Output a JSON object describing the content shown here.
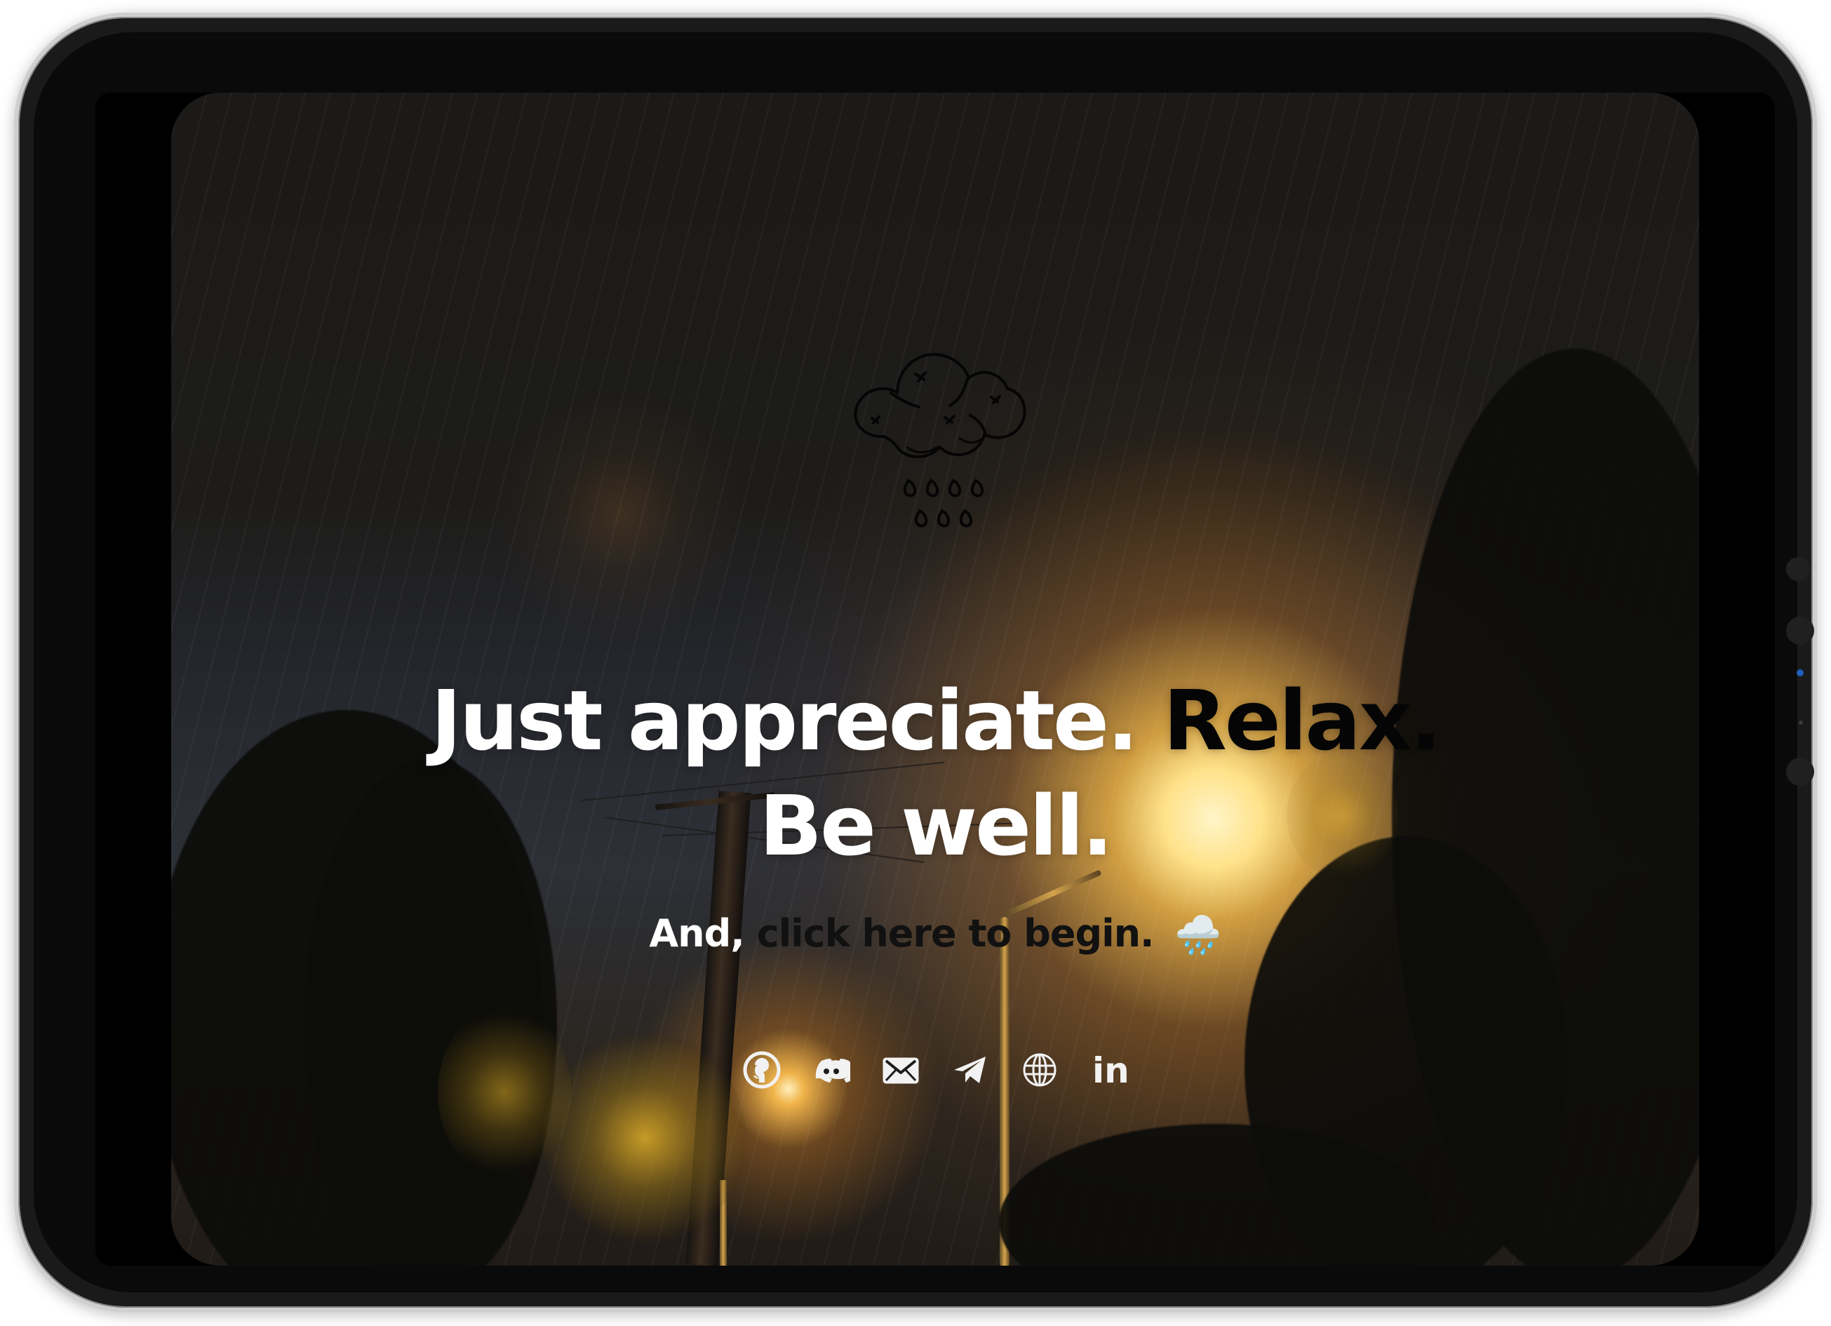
{
  "hero": {
    "headline_part1": "Just appreciate.",
    "headline_part2": "Relax.",
    "headline_line2": "Be well.",
    "cta_prefix": "And,",
    "cta_link": "click here to begin.",
    "cta_emoji": "🌧️"
  },
  "logo": {
    "icon": "rain-cloud-icon"
  },
  "social": {
    "links": [
      {
        "icon": "github-icon"
      },
      {
        "icon": "discord-icon"
      },
      {
        "icon": "email-icon"
      },
      {
        "icon": "telegram-icon"
      },
      {
        "icon": "globe-icon"
      },
      {
        "icon": "linkedin-icon",
        "label": "in"
      }
    ]
  },
  "colors": {
    "headline": "#ffffff",
    "relax": "#050505",
    "cta_link": "#111111"
  }
}
